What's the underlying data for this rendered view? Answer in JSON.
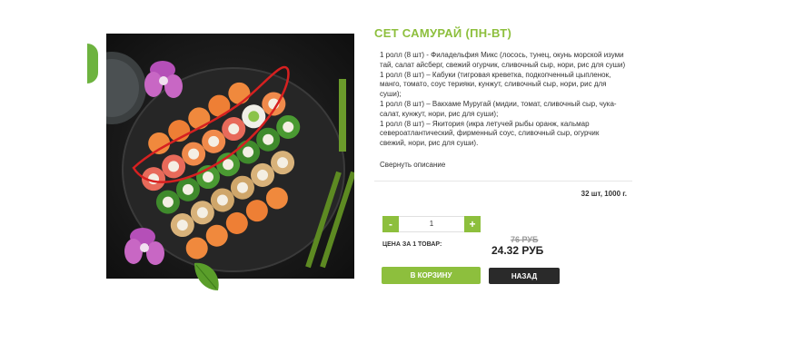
{
  "product": {
    "title": "СЕТ САМУРАЙ (ПН-ВТ)",
    "description": [
      "1 ролл (8 шт) - Филадельфия Микс (лосось, тунец, окунь морской изуми тай, салат айсберг, свежий огурчик, сливочный сыр, нори, рис для суши)",
      "1 ролл (8 шт) – Кабуки (тигровая креветка, подкопченный цыпленок, манго, томато, соус терияки, кунжут, сливочный сыр, нори, рис для суши);",
      "1 ролл (8 шт) – Вакхаме Муругай (мидии, томат, сливочный сыр, чука-салат, кунжут, нори, рис для суши);",
      "1 ролл (8 шт) – Якитория (икра летучей рыбы оранж, кальмар североатлантический, фирменный соус, сливочный сыр, огурчик свежий, нори, рис для суши)."
    ],
    "collapse_label": "Свернуть описание",
    "weight_info": "32 шт, 1000 г."
  },
  "purchase": {
    "minus_label": "-",
    "plus_label": "+",
    "quantity": "1",
    "price_label": "ЦЕНА ЗА 1 ТОВАР:",
    "old_price": "76 РУБ",
    "new_price": "24.32 РУБ",
    "cart_button": "В КОРЗИНУ",
    "back_button": "НАЗАД"
  },
  "colors": {
    "accent_green": "#8dbf3d",
    "dark_button": "#2a2a2a",
    "annotation_red": "#d62020"
  },
  "image": {
    "subject": "sushi-set-plate-icon"
  }
}
